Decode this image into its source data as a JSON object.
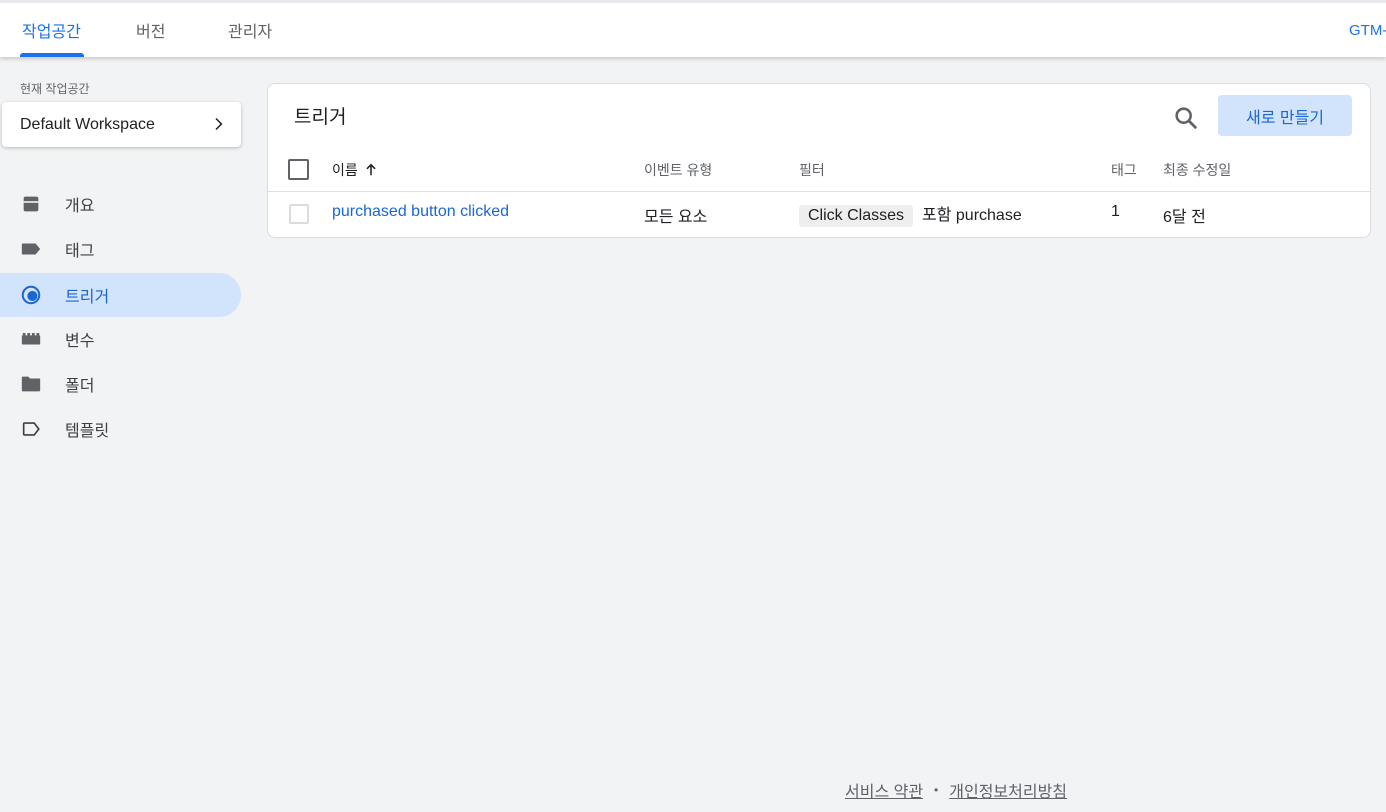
{
  "topbar": {
    "tabs": [
      {
        "label": "작업공간",
        "active": true
      },
      {
        "label": "버전",
        "active": false
      },
      {
        "label": "관리자",
        "active": false
      }
    ],
    "container_id": "GTM-"
  },
  "sidebar": {
    "workspace_label": "현재 작업공간",
    "workspace_name": "Default Workspace",
    "items": [
      {
        "label": "개요",
        "icon": "overview-icon"
      },
      {
        "label": "태그",
        "icon": "tag-icon"
      },
      {
        "label": "트리거",
        "icon": "trigger-icon",
        "active": true
      },
      {
        "label": "변수",
        "icon": "variable-icon"
      },
      {
        "label": "폴더",
        "icon": "folder-icon"
      },
      {
        "label": "템플릿",
        "icon": "template-icon"
      }
    ]
  },
  "main": {
    "title": "트리거",
    "new_button": "새로 만들기",
    "columns": [
      "이름",
      "이벤트 유형",
      "필터",
      "태그",
      "최종 수정일"
    ],
    "rows": [
      {
        "name": "purchased button clicked",
        "event_type": "모든 요소",
        "filter_variable": "Click Classes",
        "filter_condition": "포함 purchase",
        "tags": "1",
        "modified": "6달 전"
      }
    ]
  },
  "footer": {
    "terms": "서비스 약관",
    "separator": "•",
    "privacy": "개인정보처리방침"
  },
  "colors": {
    "accent": "#1a73e8",
    "active_bg": "#d2e3fc",
    "page_bg": "#f1f3f4"
  }
}
